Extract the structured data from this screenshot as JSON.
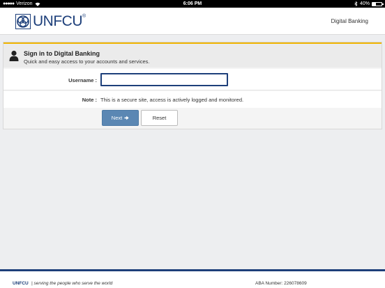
{
  "status_bar": {
    "carrier": "Verizon",
    "time": "6:06 PM",
    "battery": "40%",
    "battery_level": 0.4
  },
  "header": {
    "logo_text": "UNFCU",
    "logo_mark": "®",
    "link": "Digital Banking"
  },
  "panel": {
    "title": "Sign in to Digital Banking",
    "subtitle": "Quick and easy access to your accounts and services.",
    "username_label": "Username :",
    "username_value": "",
    "note_label": "Note :",
    "note_text": "This is a secure site, access is actively logged and monitored.",
    "next_label": "Next",
    "reset_label": "Reset"
  },
  "footer": {
    "brand": "UNFCU",
    "tagline": "| serving the people who serve the world",
    "aba": "ABA Number: 226078609"
  },
  "colors": {
    "brand_blue": "#1d3f7a",
    "accent_yellow": "#f0b400",
    "button_blue": "#5b87b3"
  }
}
